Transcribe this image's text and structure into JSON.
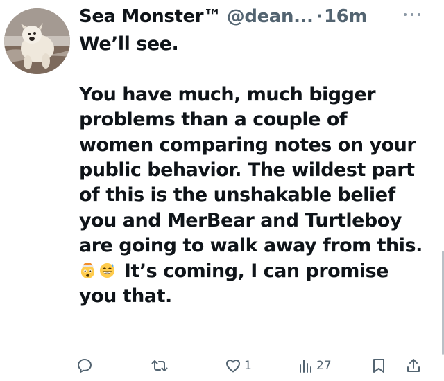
{
  "tweet": {
    "display_name": "Sea Monster™",
    "handle": "@dean...",
    "separator": "·",
    "timestamp": "16m",
    "text_line1": "We’ll see.",
    "text_paragraph": "You have much, much bigger problems than a couple of women comparing notes on your public behavior. The wildest part of this is the unshakable belief you and MerBear and Turtleboy are going to walk away from this.",
    "text_tail": "It’s coming, I can promise you that."
  },
  "actions": {
    "like_count": "1",
    "views_count": "27"
  },
  "icons": {
    "more": "more-horizontal-icon",
    "reply": "reply-icon",
    "retweet": "retweet-icon",
    "like": "heart-icon",
    "views": "analytics-icon",
    "bookmark": "bookmark-icon",
    "share": "share-icon",
    "emoji1": "exploding-head-emoji",
    "emoji2": "grinning-sweat-emoji"
  },
  "colors": {
    "text": "#0f1419",
    "secondary": "#536471",
    "background": "#ffffff"
  }
}
